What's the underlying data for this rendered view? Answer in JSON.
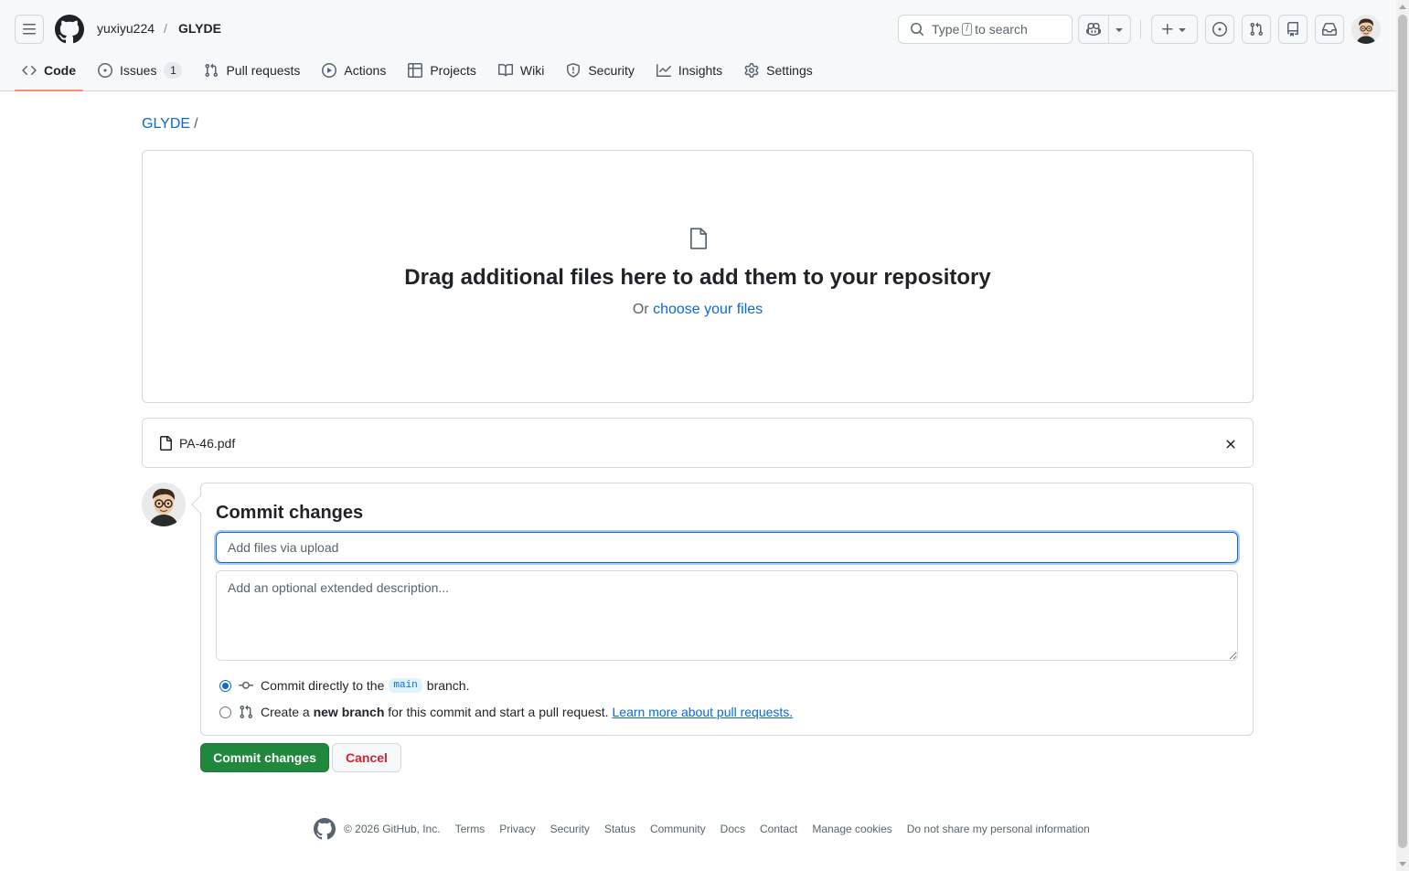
{
  "header": {
    "owner": "yuxiyu224",
    "separator": "/",
    "repo": "GLYDE",
    "search": {
      "prefix": "Type",
      "key": "/",
      "suffix": "to search"
    }
  },
  "nav": {
    "tabs": [
      {
        "label": "Code",
        "icon": "code-icon",
        "active": true
      },
      {
        "label": "Issues",
        "icon": "issue-opened-icon",
        "count": "1"
      },
      {
        "label": "Pull requests",
        "icon": "git-pull-request-icon"
      },
      {
        "label": "Actions",
        "icon": "play-icon"
      },
      {
        "label": "Projects",
        "icon": "table-icon"
      },
      {
        "label": "Wiki",
        "icon": "book-icon"
      },
      {
        "label": "Security",
        "icon": "shield-icon"
      },
      {
        "label": "Insights",
        "icon": "graph-icon"
      },
      {
        "label": "Settings",
        "icon": "gear-icon"
      }
    ]
  },
  "breadcrumb": {
    "repo": "GLYDE",
    "slash": "/"
  },
  "dropzone": {
    "title": "Drag additional files here to add them to your repository",
    "or_text": "Or",
    "choose_link": "choose your files"
  },
  "uploaded_file": {
    "name": "PA-46.pdf"
  },
  "commit": {
    "heading": "Commit changes",
    "summary_placeholder": "Add files via upload",
    "description_placeholder": "Add an optional extended description...",
    "option_direct": {
      "prefix": "Commit directly to the",
      "branch": "main",
      "suffix": "branch."
    },
    "option_new": {
      "prefix": "Create a",
      "bold": "new branch",
      "suffix": "for this commit and start a pull request.",
      "link": "Learn more about pull requests."
    },
    "submit_label": "Commit changes",
    "cancel_label": "Cancel"
  },
  "footer": {
    "copyright": "© 2026 GitHub, Inc.",
    "links": [
      "Terms",
      "Privacy",
      "Security",
      "Status",
      "Community",
      "Docs",
      "Contact",
      "Manage cookies",
      "Do not share my personal information"
    ]
  },
  "colors": {
    "accent": "#0969da",
    "primary_button": "#1f883d",
    "danger": "#d1242f",
    "active_tab_underline": "#fd8c73"
  }
}
